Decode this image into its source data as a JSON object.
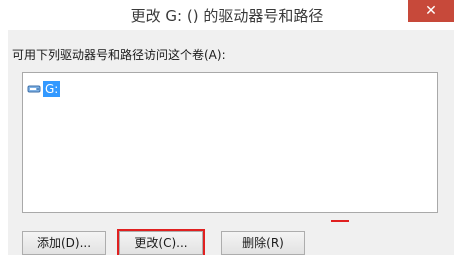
{
  "window": {
    "title": "更改 G: () 的驱动器号和路径",
    "close_glyph": "✕"
  },
  "dialog": {
    "instruction": "可用下列驱动器号和路径访问这个卷(A):",
    "list_items": [
      {
        "label": "G:",
        "icon": "drive-icon"
      }
    ]
  },
  "buttons": {
    "add_label": "添加(D)...",
    "change_label": "更改(C)...",
    "delete_label": "删除(R)"
  },
  "colors": {
    "selection": "#3399ff",
    "highlight_outline": "#e02020",
    "close_button": "#c7493a"
  }
}
